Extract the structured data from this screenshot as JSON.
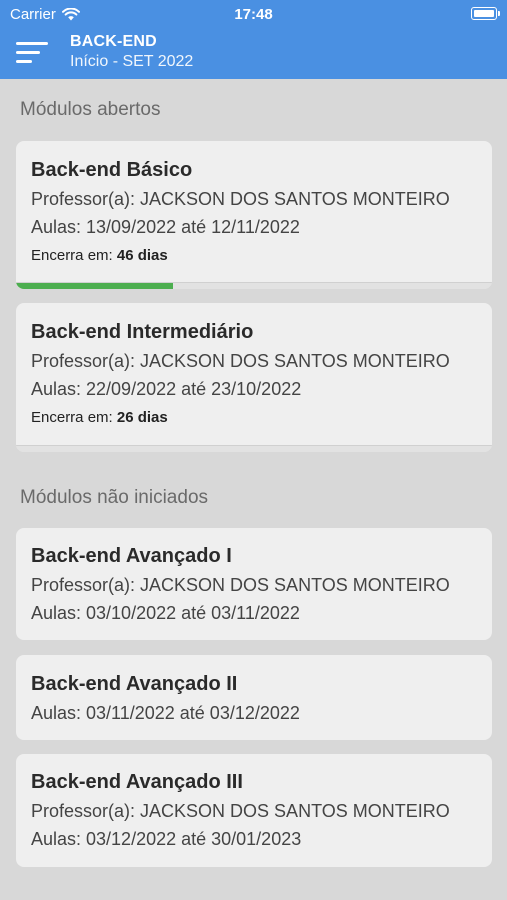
{
  "status_bar": {
    "carrier": "Carrier",
    "time": "17:48",
    "wifi_icon": "wifi-icon",
    "battery_icon": "battery-icon"
  },
  "app_bar": {
    "title": "BACK-END",
    "subtitle": "Início - SET 2022",
    "menu_icon": "menu-icon",
    "color": "#4a90e2"
  },
  "sections": {
    "open": "Módulos abertos",
    "not_started": "Módulos não iniciados"
  },
  "ends_label": "Encerra em:",
  "progress_color": "#4cae4f",
  "open_modules": [
    {
      "name": "Back-end Básico",
      "teacher": "Professor(a): JACKSON DOS SANTOS MONTEIRO",
      "classes": "Aulas: 13/09/2022 até 12/11/2022",
      "ends_in": "46 dias",
      "progress": 0.33
    },
    {
      "name": "Back-end Intermediário",
      "teacher": "Professor(a): JACKSON DOS SANTOS MONTEIRO",
      "classes": "Aulas: 22/09/2022 até 23/10/2022",
      "ends_in": "26 dias",
      "progress": 0.0
    }
  ],
  "pending_modules": [
    {
      "name": "Back-end Avançado I",
      "teacher": "Professor(a): JACKSON DOS SANTOS MONTEIRO",
      "classes": "Aulas: 03/10/2022 até 03/11/2022"
    },
    {
      "name": "Back-end Avançado II",
      "classes": "Aulas: 03/11/2022 até 03/12/2022"
    },
    {
      "name": "Back-end Avançado III",
      "teacher": "Professor(a): JACKSON DOS SANTOS MONTEIRO",
      "classes": "Aulas: 03/12/2022 até 30/01/2023"
    }
  ]
}
